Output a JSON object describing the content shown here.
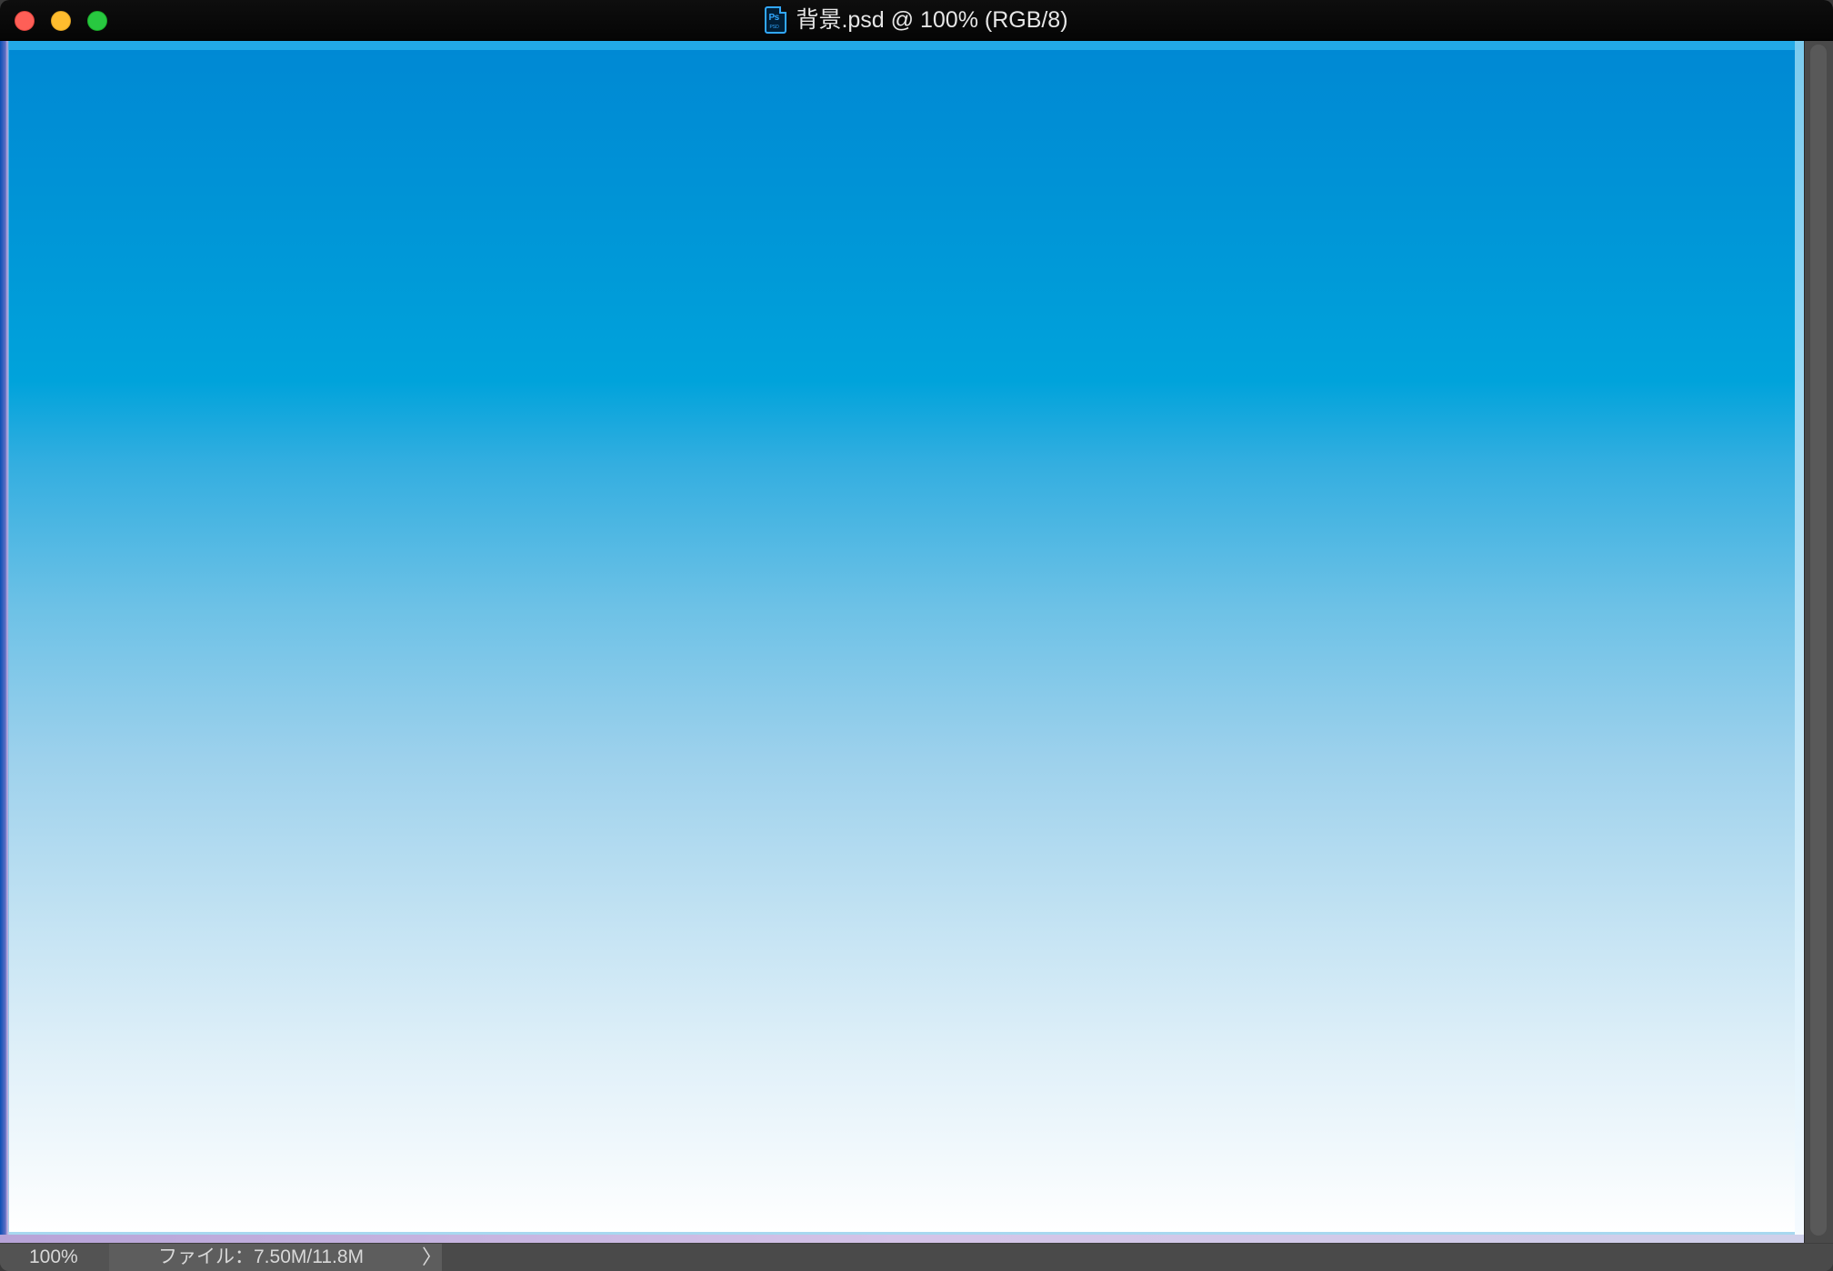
{
  "window": {
    "title": "背景.psd @ 100% (RGB/8)",
    "app_icon": "photoshop-psd-file-icon",
    "app_icon_letters": "Ps",
    "app_icon_ext": "PSD"
  },
  "traffic_lights": {
    "close_color": "#fe5f57",
    "minimize_color": "#febc2e",
    "zoom_color": "#28c840"
  },
  "canvas": {
    "fill": "vertical gradient",
    "gradient_top_color": "#0089d4",
    "gradient_mid_color": "#00a3db",
    "gradient_bottom_color": "#ffffff"
  },
  "statusbar": {
    "zoom_level": "100%",
    "doc_info": "ファイル：7.50M/11.8M",
    "arrow": "〉"
  }
}
